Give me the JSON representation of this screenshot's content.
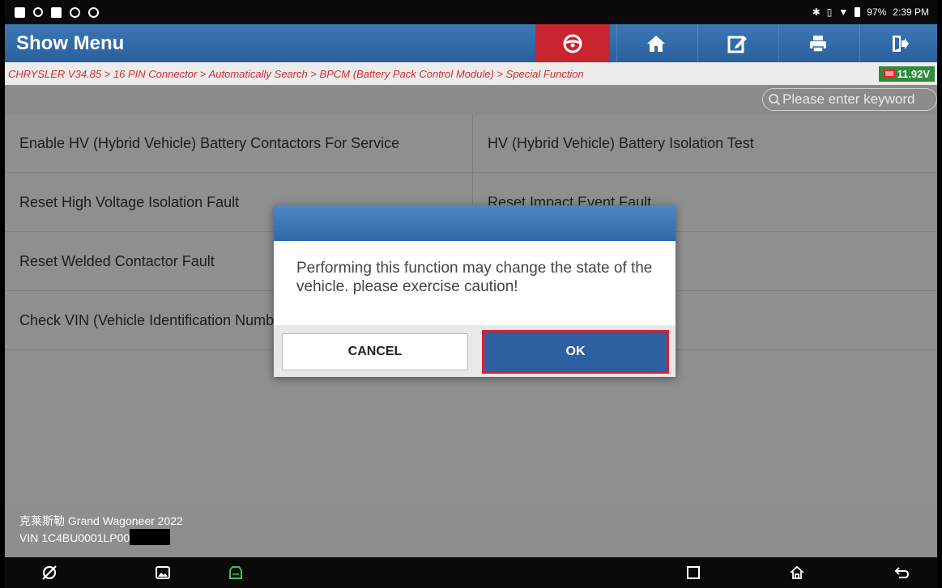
{
  "status_bar": {
    "battery": "97%",
    "time": "2:39 PM"
  },
  "header": {
    "title": "Show Menu"
  },
  "toolbar": {
    "icons": [
      "steering-wheel-icon",
      "home-icon",
      "edit-icon",
      "print-icon",
      "exit-icon"
    ]
  },
  "breadcrumb": "CHRYSLER V34.85 > 16 PIN Connector > Automatically Search > BPCM (Battery Pack Control Module) > Special Function",
  "voltage": "11.92V",
  "search": {
    "placeholder": "Please enter keyword"
  },
  "menu": {
    "rows": [
      {
        "left": "Enable HV (Hybrid Vehicle) Battery Contactors For Service",
        "right": "HV (Hybrid Vehicle) Battery Isolation Test"
      },
      {
        "left": "Reset High Voltage Isolation Fault",
        "right": "Reset Impact Event Fault"
      },
      {
        "left": "Reset Welded Contactor Fault",
        "right": ""
      },
      {
        "left": "Check VIN (Vehicle Identification Number)",
        "right": ""
      }
    ]
  },
  "vehicle": {
    "name": "克莱斯勒 Grand Wagoneer 2022",
    "vin_prefix": "VIN 1C4BU0001LP00"
  },
  "dialog": {
    "message": "Performing this function may change the state of the vehicle. please exercise caution!",
    "cancel_label": "CANCEL",
    "ok_label": "OK"
  },
  "colors": {
    "header_blue": "#2f6aa8",
    "breadcrumb_red": "#d82c2c",
    "highlight_red": "#e01e2c",
    "voltage_green": "#2e8b3a"
  }
}
